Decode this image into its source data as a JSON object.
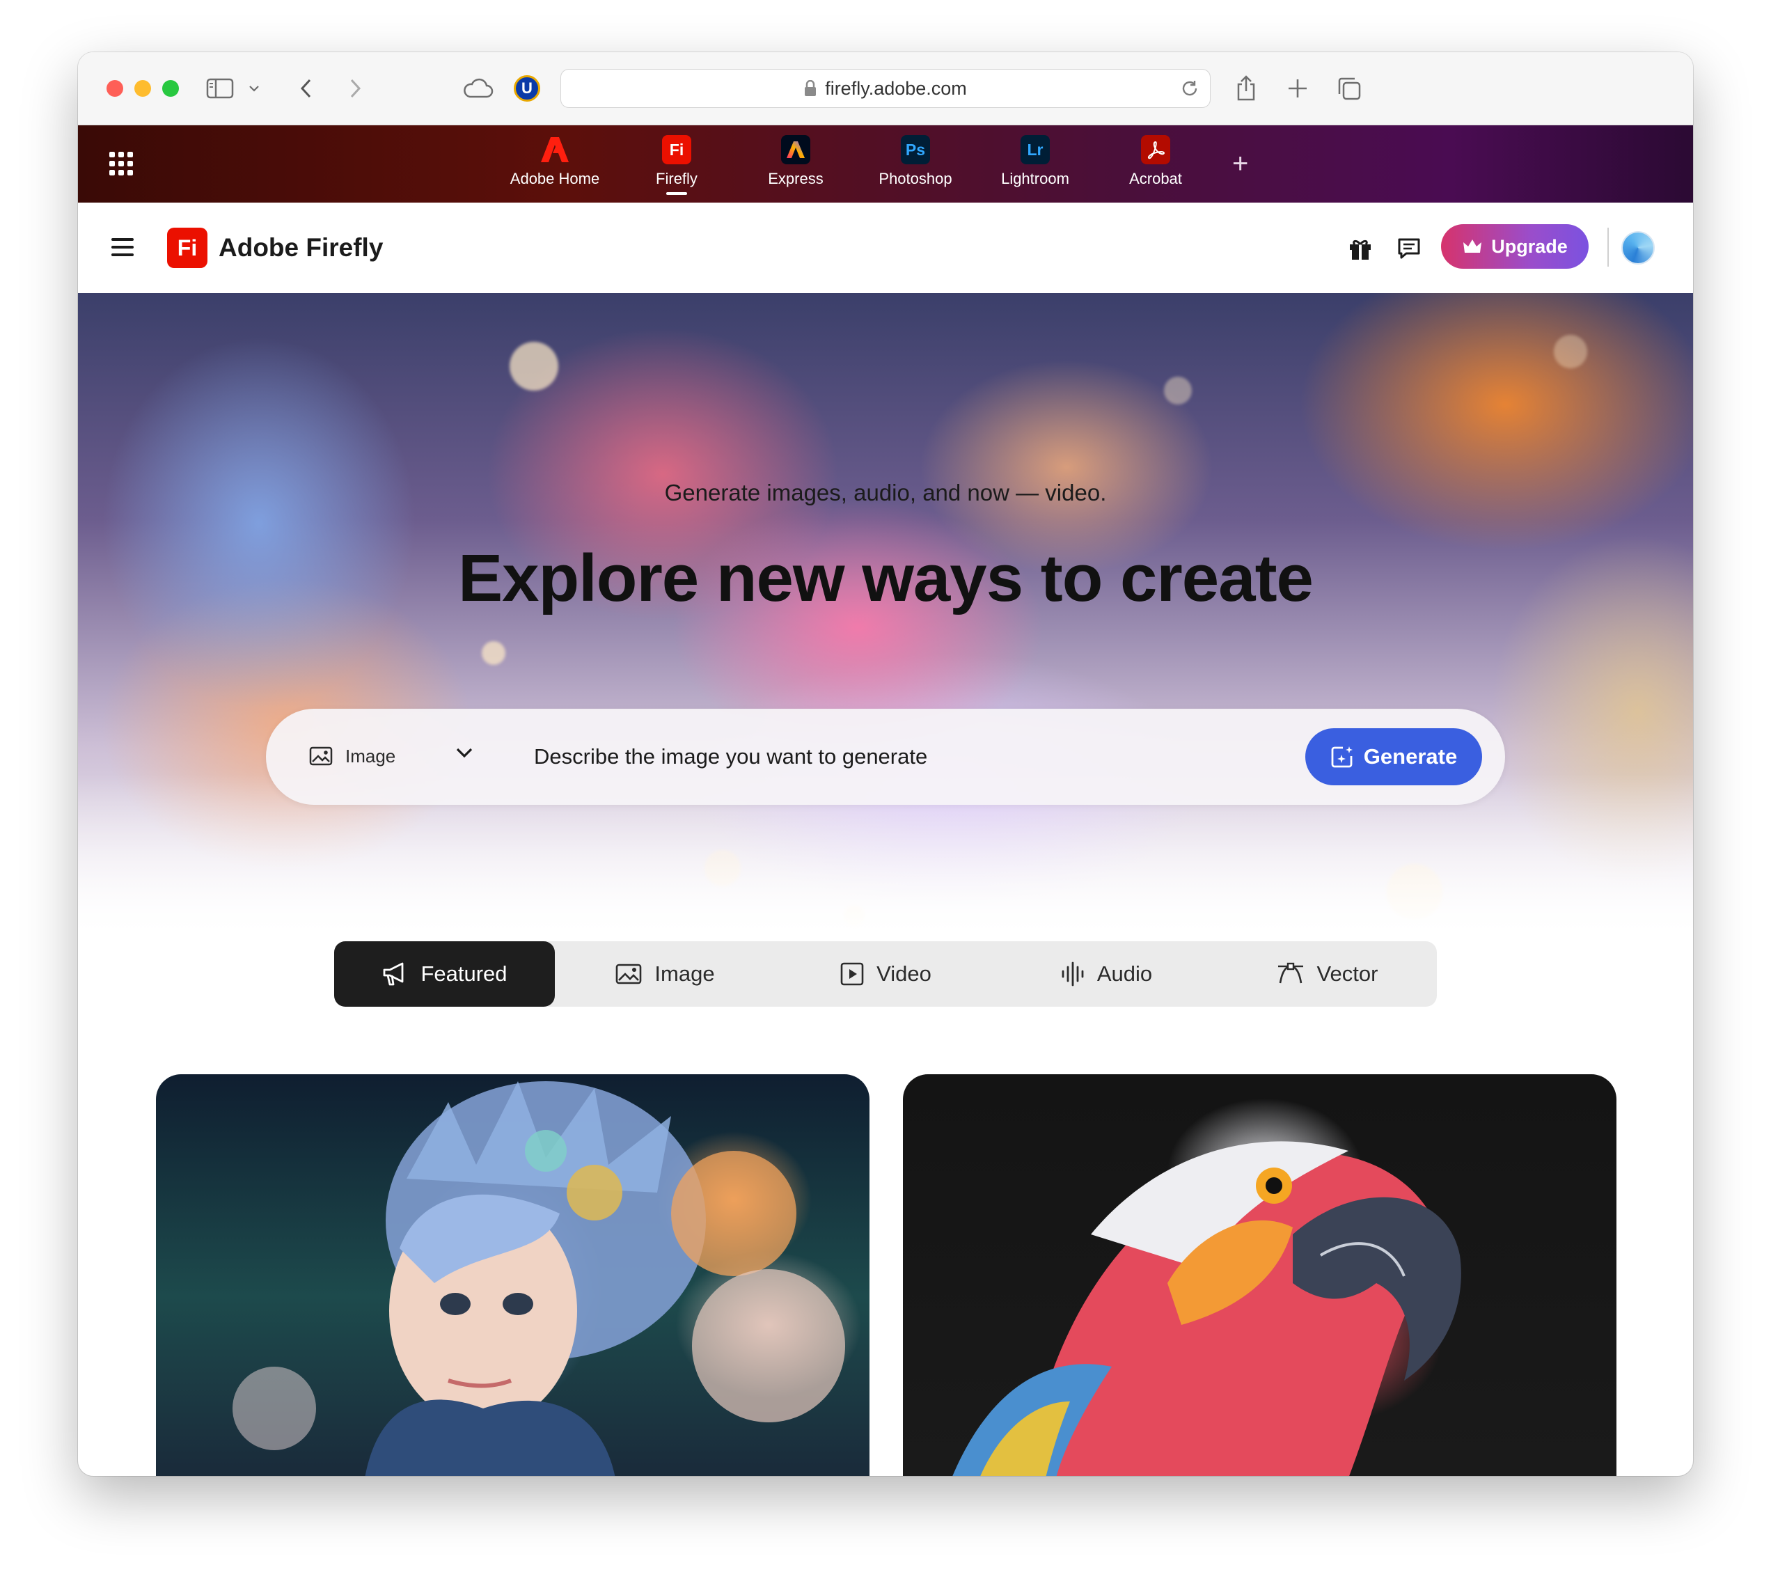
{
  "browser": {
    "url": "firefly.adobe.com"
  },
  "app_switcher": {
    "items": [
      {
        "label": "Adobe Home",
        "logo": "",
        "color": "#eb1000"
      },
      {
        "label": "Firefly",
        "logo": "Fi",
        "color": "#eb1000"
      },
      {
        "label": "Express",
        "logo": "",
        "color": "#000b1d"
      },
      {
        "label": "Photoshop",
        "logo": "Ps",
        "color": "#001e36"
      },
      {
        "label": "Lightroom",
        "logo": "Lr",
        "color": "#001e36"
      },
      {
        "label": "Acrobat",
        "logo": "",
        "color": "#b30b00"
      }
    ],
    "active": "Firefly"
  },
  "header": {
    "logo_text": "Fi",
    "title": "Adobe Firefly",
    "upgrade_label": "Upgrade"
  },
  "hero": {
    "subtitle": "Generate images, audio, and now — video.",
    "title": "Explore new ways to create",
    "type_select": "Image",
    "prompt_placeholder": "Describe the image you want to generate",
    "generate_label": "Generate"
  },
  "tabs": [
    {
      "label": "Featured",
      "icon": "megaphone-icon",
      "active": true
    },
    {
      "label": "Image",
      "icon": "image-icon",
      "active": false
    },
    {
      "label": "Video",
      "icon": "video-icon",
      "active": false
    },
    {
      "label": "Audio",
      "icon": "audio-icon",
      "active": false
    },
    {
      "label": "Vector",
      "icon": "vector-icon",
      "active": false
    }
  ],
  "colors": {
    "accent": "#3a5fe0",
    "brand": "#eb1000"
  }
}
